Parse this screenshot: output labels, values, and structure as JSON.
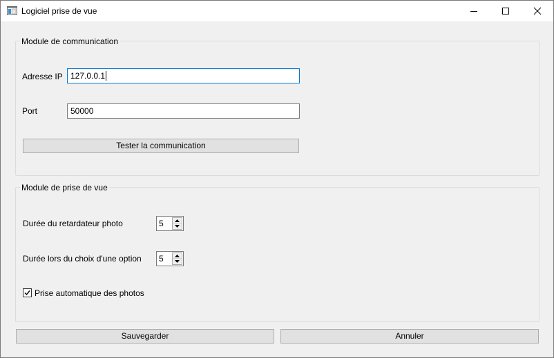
{
  "window": {
    "title": "Logiciel prise de vue",
    "controls": [
      "minimize-icon",
      "maximize-icon",
      "close-icon"
    ]
  },
  "communication": {
    "group_title": "Module de communication",
    "ip_label": "Adresse IP",
    "ip_value": "127.0.0.1",
    "port_label": "Port",
    "port_value": "50000",
    "test_button": "Tester la communication"
  },
  "capture": {
    "group_title": "Module de prise de vue",
    "timer_label": "Durée du retardateur photo",
    "timer_value": "5",
    "option_label": "Durée lors du choix d'une option",
    "option_value": "5",
    "auto_label": "Prise automatique des photos",
    "auto_checked": true
  },
  "footer": {
    "save_button": "Sauvegarder",
    "cancel_button": "Annuler"
  },
  "colors": {
    "background": "#f0f0f0",
    "titlebar": "#ffffff",
    "focus_border": "#0078d7",
    "button_face": "#e1e1e1"
  }
}
